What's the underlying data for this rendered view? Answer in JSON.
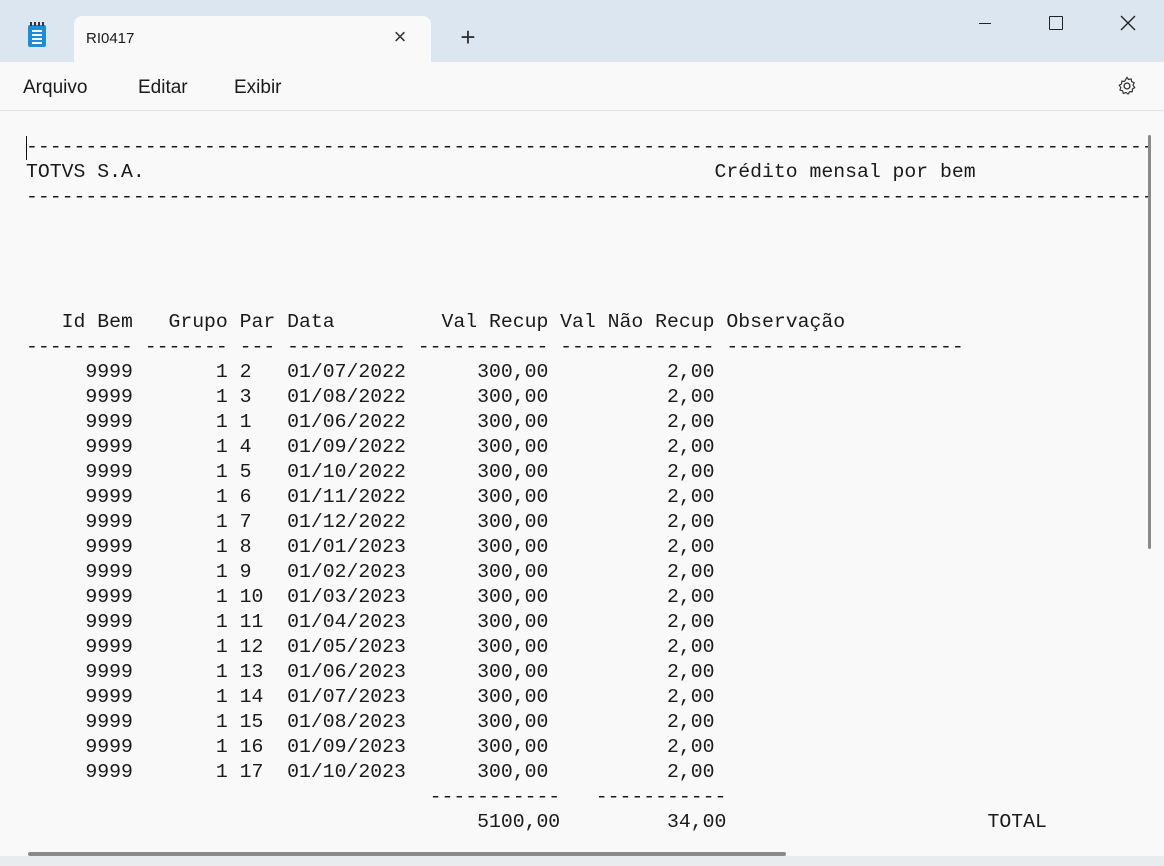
{
  "window": {
    "tab_title": "RI0417",
    "icon": "notepad-icon"
  },
  "menu": {
    "file": "Arquivo",
    "edit": "Editar",
    "view": "Exibir",
    "settings_icon": "gear-icon"
  },
  "document": {
    "lines": [
      "------------------------------------------------------------------------------------------------------------------------------------------",
      "TOTVS S.A.                                                Crédito mensal por bem",
      "------------------------------------------------------------------------------------------------------------------------------------------",
      "",
      "",
      "",
      "",
      "   Id Bem   Grupo Par Data         Val Recup Val Não Recup Observação",
      "--------- ------- --- ---------- ----------- ------------- --------------------",
      "     9999       1 2   01/07/2022      300,00          2,00",
      "     9999       1 3   01/08/2022      300,00          2,00",
      "     9999       1 1   01/06/2022      300,00          2,00",
      "     9999       1 4   01/09/2022      300,00          2,00",
      "     9999       1 5   01/10/2022      300,00          2,00",
      "     9999       1 6   01/11/2022      300,00          2,00",
      "     9999       1 7   01/12/2022      300,00          2,00",
      "     9999       1 8   01/01/2023      300,00          2,00",
      "     9999       1 9   01/02/2023      300,00          2,00",
      "     9999       1 10  01/03/2023      300,00          2,00",
      "     9999       1 11  01/04/2023      300,00          2,00",
      "     9999       1 12  01/05/2023      300,00          2,00",
      "     9999       1 13  01/06/2023      300,00          2,00",
      "     9999       1 14  01/07/2023      300,00          2,00",
      "     9999       1 15  01/08/2023      300,00          2,00",
      "     9999       1 16  01/09/2023      300,00          2,00",
      "     9999       1 17  01/10/2023      300,00          2,00",
      "                                  -----------   -----------",
      "                                      5100,00         34,00                      TOTAL"
    ]
  }
}
